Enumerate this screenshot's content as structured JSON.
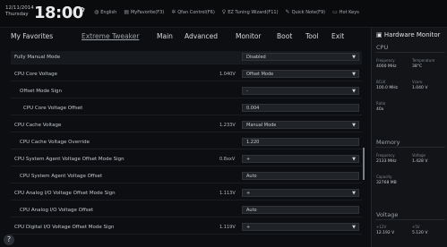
{
  "topbar": {
    "date": "12/11/2014",
    "day": "Thursday",
    "time": "18:00",
    "items": [
      {
        "icon": "globe-icon",
        "glyph": "◍",
        "label": "English"
      },
      {
        "icon": "star-list-icon",
        "glyph": "▤",
        "label": "MyFavorite(F3)"
      },
      {
        "icon": "fan-icon",
        "glyph": "✲",
        "label": "Qfan Control(F6)"
      },
      {
        "icon": "bulb-icon",
        "glyph": "♀",
        "label": "EZ Tuning Wizard(F11)"
      },
      {
        "icon": "note-icon",
        "glyph": "✎",
        "label": "Quick Note(F9)"
      },
      {
        "icon": "keyboard-icon",
        "glyph": "▭",
        "label": "Hot Keys"
      }
    ]
  },
  "nav": {
    "tabs": [
      "My Favorites",
      "Extreme Tweaker",
      "Main",
      "Advanced",
      "Monitor",
      "Boot",
      "Tool",
      "Exit"
    ],
    "active": "Extreme Tweaker"
  },
  "settings": [
    {
      "label": "Fully Manual Mode",
      "voltage": "",
      "value": "Disabled",
      "type": "select"
    },
    {
      "label": "CPU Core Voltage",
      "voltage": "1.040V",
      "value": "Offset Mode",
      "type": "select"
    },
    {
      "label": "Offset Mode Sign",
      "voltage": "",
      "value": "-",
      "type": "select"
    },
    {
      "label": "CPU Core Voltage Offset",
      "voltage": "",
      "value": "0.004",
      "type": "input"
    },
    {
      "label": "CPU Cache Voltage",
      "voltage": "1.233V",
      "value": "Manual Mode",
      "type": "select"
    },
    {
      "label": "CPU Cache Voltage Override",
      "voltage": "",
      "value": "1.220",
      "type": "input"
    },
    {
      "label": "CPU System Agent Voltage Offset Mode Sign",
      "voltage": "0.8xxV",
      "value": "+",
      "type": "select"
    },
    {
      "label": "CPU System Agent Voltage Offset",
      "voltage": "",
      "value": "Auto",
      "type": "input"
    },
    {
      "label": "CPU Analog I/O Voltage Offset Mode Sign",
      "voltage": "1.113V",
      "value": "+",
      "type": "select"
    },
    {
      "label": "CPU Analog I/O Voltage Offset",
      "voltage": "",
      "value": "Auto",
      "type": "input"
    },
    {
      "label": "CPU Digital I/O Voltage Offset Mode Sign",
      "voltage": "1.119V",
      "value": "+",
      "type": "select"
    }
  ],
  "hw": {
    "title": "Hardware Monitor",
    "cpu": {
      "section": "CPU",
      "freq_label": "Frequency",
      "freq": "4000 MHz",
      "temp_label": "Temperature",
      "temp": "38°C",
      "bclk_label": "BCLK",
      "bclk": "100.0 MHz",
      "vcore_label": "Vcore",
      "vcore": "1.040 V",
      "ratio_label": "Ratio",
      "ratio": "40x"
    },
    "memory": {
      "section": "Memory",
      "freq_label": "Frequency",
      "freq": "2133 MHz",
      "volt_label": "Voltage",
      "volt": "1.428 V",
      "cap_label": "Capacity",
      "cap": "32768 MB"
    },
    "voltage": {
      "section": "Voltage",
      "v12_label": "+12V",
      "v12": "12.192 V",
      "v5_label": "+5V",
      "v5": "5.120 V"
    }
  }
}
